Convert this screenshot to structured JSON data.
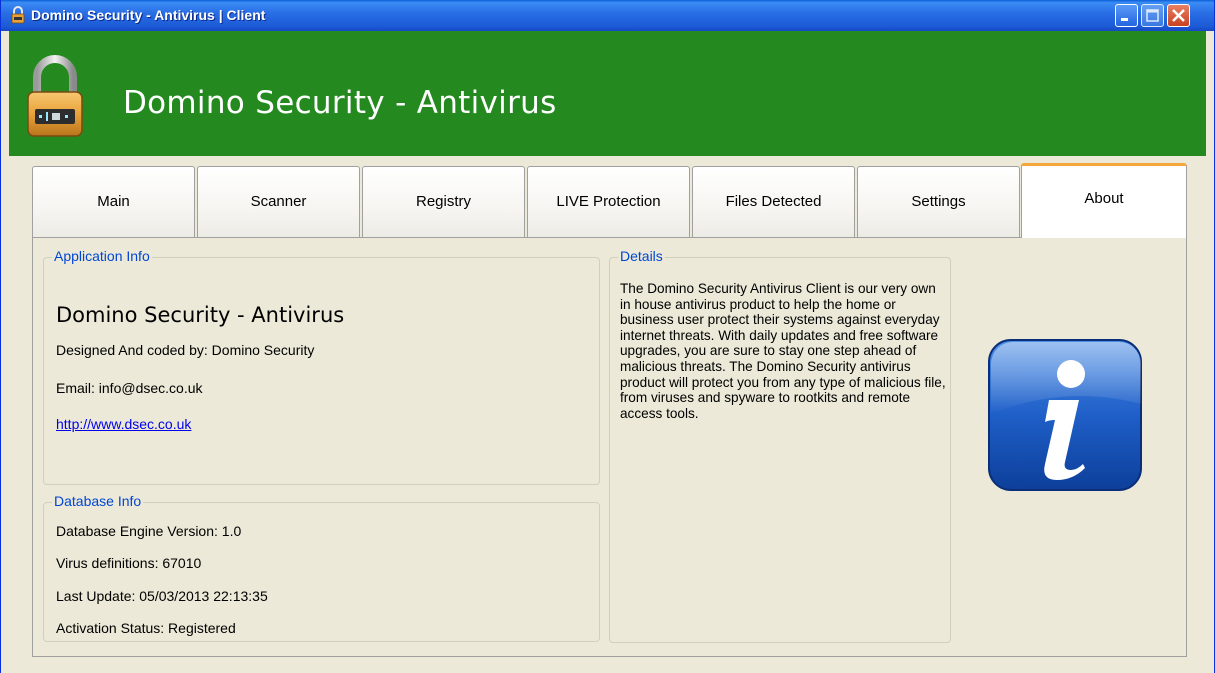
{
  "window": {
    "title": "Domino Security - Antivirus | Client",
    "icons": {
      "title": "lock-icon",
      "minimize": "minimize-icon",
      "maximize": "maximize-icon",
      "close": "close-icon"
    }
  },
  "banner": {
    "title": "Domino Security - Antivirus",
    "icon": "padlock-icon",
    "color": "#248a1f"
  },
  "tabs": [
    {
      "label": "Main",
      "active": false
    },
    {
      "label": "Scanner",
      "active": false
    },
    {
      "label": "Registry",
      "active": false
    },
    {
      "label": "LIVE Protection",
      "active": false
    },
    {
      "label": "Files Detected",
      "active": false
    },
    {
      "label": "Settings",
      "active": false
    },
    {
      "label": "About",
      "active": true
    }
  ],
  "application_info": {
    "legend": "Application Info",
    "name": "Domino Security - Antivirus",
    "designed_by": "Designed And coded by: Domino Security",
    "email": "Email: info@dsec.co.uk",
    "website": "http://www.dsec.co.uk"
  },
  "database_info": {
    "legend": "Database Info",
    "engine_version": "Database Engine Version: 1.0",
    "virus_definitions": "Virus definitions: 67010",
    "last_update": "Last Update: 05/03/2013 22:13:35",
    "activation_status": "Activation Status: Registered"
  },
  "details": {
    "legend": "Details",
    "text": "The Domino Security Antivirus Client is our very own in house antivirus product to help the home or business user protect their systems against everyday internet threats. With daily updates and free software upgrades, you are sure to stay one step ahead of malicious threats. The Domino Security antivirus product will protect you from any type of malicious file, from viruses and spyware to rootkits and remote access tools."
  },
  "about_icon": "info-icon",
  "colors": {
    "accent_tab": "#f4a63a",
    "legend_text": "#0046d5",
    "titlebar": "#2a6fe6"
  }
}
